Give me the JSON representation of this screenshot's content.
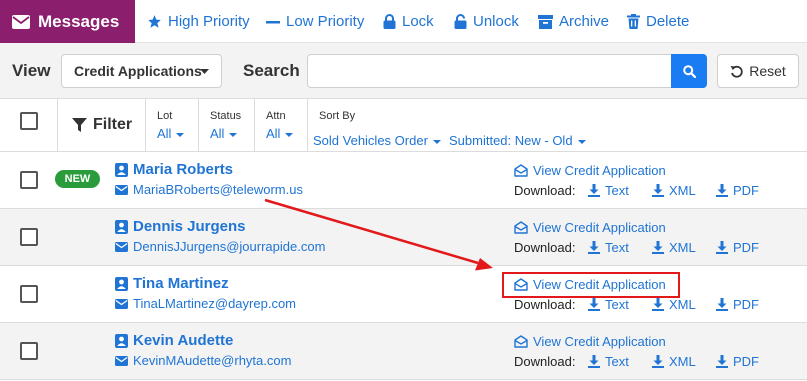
{
  "toolbar": {
    "messages_label": "Messages",
    "high_priority_label": "High Priority",
    "low_priority_label": "Low Priority",
    "lock_label": "Lock",
    "unlock_label": "Unlock",
    "archive_label": "Archive",
    "delete_label": "Delete"
  },
  "viewbar": {
    "view_label": "View",
    "view_selected": "Credit Applications",
    "search_label": "Search",
    "search_value": "",
    "search_placeholder": "",
    "reset_label": "Reset"
  },
  "filters": {
    "filter_label": "Filter",
    "lot": {
      "label": "Lot",
      "value": "All"
    },
    "status": {
      "label": "Status",
      "value": "All"
    },
    "attn": {
      "label": "Attn",
      "value": "All"
    },
    "sort": {
      "label": "Sort By",
      "value": "Sold Vehicles Order",
      "submitted": "Submitted: New - Old"
    }
  },
  "rows": [
    {
      "badge": "NEW",
      "name": "Maria Roberts",
      "email": "MariaBRoberts@teleworm.us",
      "view_link": "View Credit Application",
      "download_label": "Download:",
      "text_link": "Text",
      "xml_link": "XML",
      "pdf_link": "PDF"
    },
    {
      "badge": "",
      "name": "Dennis Jurgens",
      "email": "DennisJJurgens@jourrapide.com",
      "view_link": "View Credit Application",
      "download_label": "Download:",
      "text_link": "Text",
      "xml_link": "XML",
      "pdf_link": "PDF"
    },
    {
      "badge": "",
      "name": "Tina Martinez",
      "email": "TinaLMartinez@dayrep.com",
      "view_link": "View Credit Application",
      "download_label": "Download:",
      "text_link": "Text",
      "xml_link": "XML",
      "pdf_link": "PDF"
    },
    {
      "badge": "",
      "name": "Kevin Audette",
      "email": "KevinMAudette@rhyta.com",
      "view_link": "View Credit Application",
      "download_label": "Download:",
      "text_link": "Text",
      "xml_link": "XML",
      "pdf_link": "PDF"
    }
  ],
  "colors": {
    "brand": "#8b1f6e",
    "link": "#1f74d4",
    "search_button": "#1a7cf3",
    "new_badge": "#2b9c3c",
    "annotation": "#e3181b"
  }
}
